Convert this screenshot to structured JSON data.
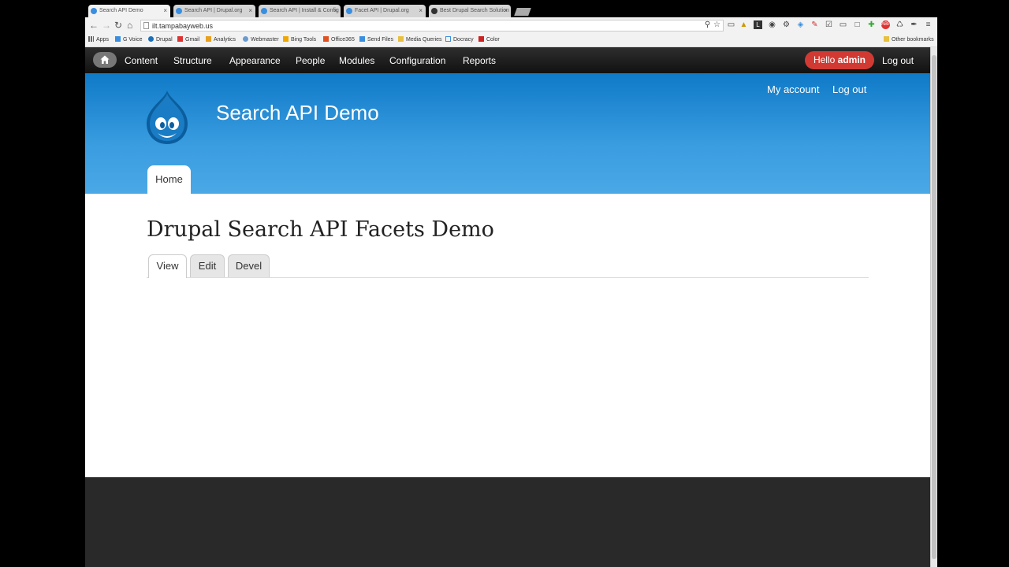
{
  "browser": {
    "tabs": [
      {
        "label": "Search API Demo",
        "active": true
      },
      {
        "label": "Search API | Drupal.org",
        "active": false
      },
      {
        "label": "Search API | Install & Config",
        "active": false
      },
      {
        "label": "Facet API | Drupal.org",
        "active": false
      },
      {
        "label": "Best Drupal Search Solution",
        "active": false
      }
    ],
    "close_glyph": "×",
    "url": "ilt.tampabayweb.us",
    "bookmarks": [
      {
        "label": "Apps",
        "icon": "apps-icon"
      },
      {
        "label": "G Voice",
        "icon": "voice-icon"
      },
      {
        "label": "Drupal",
        "icon": "drupal-icon"
      },
      {
        "label": "Gmail",
        "icon": "gmail-icon"
      },
      {
        "label": "Analytics",
        "icon": "analytics-icon"
      },
      {
        "label": "Webmaster",
        "icon": "webmaster-icon"
      },
      {
        "label": "Bing Tools",
        "icon": "bing-icon"
      },
      {
        "label": "Office365",
        "icon": "office-icon"
      },
      {
        "label": "Send Files",
        "icon": "sendfiles-icon"
      },
      {
        "label": "Media Queries",
        "icon": "folder-icon"
      },
      {
        "label": "Docracy",
        "icon": "docracy-icon"
      },
      {
        "label": "Color",
        "icon": "color-icon"
      }
    ],
    "other_bookmarks": "Other bookmarks"
  },
  "admin_menu": {
    "items": [
      "Content",
      "Structure",
      "Appearance",
      "People",
      "Modules",
      "Configuration",
      "Reports"
    ],
    "hello_prefix": "Hello",
    "hello_user": "admin",
    "logout": "Log out"
  },
  "site": {
    "name": "Search API Demo",
    "secondary_links": [
      "My account",
      "Log out"
    ],
    "main_tab": "Home",
    "brand_color": "#0f7ac8"
  },
  "page": {
    "title": "Drupal Search API Facets Demo",
    "tabs": [
      "View",
      "Edit",
      "Devel"
    ]
  }
}
